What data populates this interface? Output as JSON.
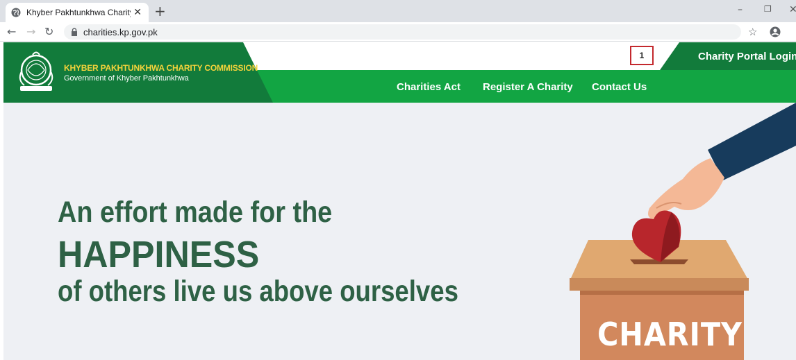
{
  "browser": {
    "tab_title": "Khyber Pakhtunkhwa Charity Cor",
    "url": "charities.kp.gov.pk"
  },
  "header": {
    "org_title": "KHYBER PAKHTUNKHWA CHARITY COMMISSION",
    "org_subtitle": "Government of Khyber Pakhtunkhwa",
    "login_label": "Charity Portal Login",
    "annotation_marker": "1"
  },
  "nav": {
    "items": [
      {
        "label": "Charities Act"
      },
      {
        "label": "Register A Charity"
      },
      {
        "label": "Contact Us"
      }
    ]
  },
  "hero": {
    "line1": "An effort made for the",
    "line2": "HAPPINESS",
    "line3": "of others live us above ourselves",
    "box_label": "CHARITY"
  },
  "colors": {
    "primary_green": "#12a543",
    "dark_green": "#127b3b",
    "brand_yellow": "#f5d33b",
    "hero_text": "#2e6145",
    "marker_red": "#c3282d"
  }
}
